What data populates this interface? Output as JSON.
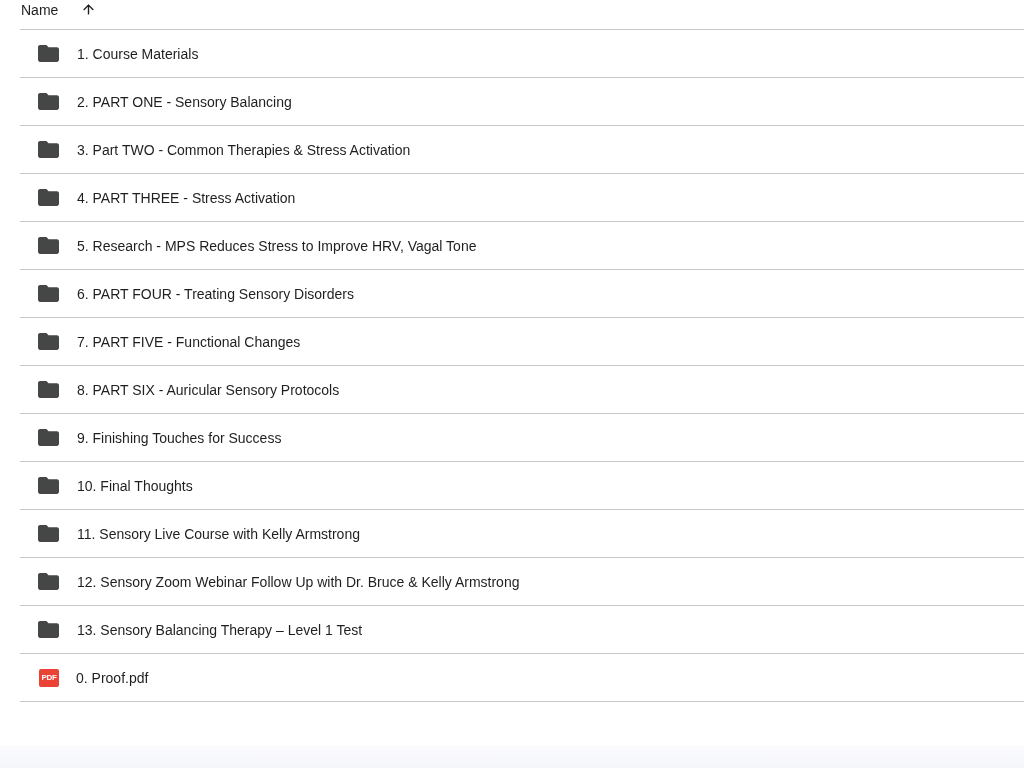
{
  "header": {
    "column": "Name",
    "sort_ascending": true
  },
  "rows": [
    {
      "kind": "folder",
      "name": "1. Course Materials"
    },
    {
      "kind": "folder",
      "name": "2. PART ONE - Sensory Balancing"
    },
    {
      "kind": "folder",
      "name": "3. Part TWO - Common Therapies & Stress Activation"
    },
    {
      "kind": "folder",
      "name": "4. PART THREE - Stress Activation"
    },
    {
      "kind": "folder",
      "name": "5. Research - MPS Reduces Stress to Improve HRV, Vagal Tone"
    },
    {
      "kind": "folder",
      "name": "6. PART FOUR - Treating Sensory Disorders"
    },
    {
      "kind": "folder",
      "name": "7. PART FIVE - Functional Changes"
    },
    {
      "kind": "folder",
      "name": "8. PART SIX - Auricular Sensory Protocols"
    },
    {
      "kind": "folder",
      "name": "9. Finishing Touches for Success"
    },
    {
      "kind": "folder",
      "name": "10. Final Thoughts"
    },
    {
      "kind": "folder",
      "name": "11. Sensory Live Course with Kelly Armstrong"
    },
    {
      "kind": "folder",
      "name": "12. Sensory Zoom Webinar Follow Up with Dr. Bruce & Kelly Armstrong"
    },
    {
      "kind": "folder",
      "name": "13. Sensory Balancing Therapy – Level 1 Test"
    },
    {
      "kind": "pdf",
      "name": "0. Proof.pdf",
      "icon_text": "PDF"
    }
  ]
}
